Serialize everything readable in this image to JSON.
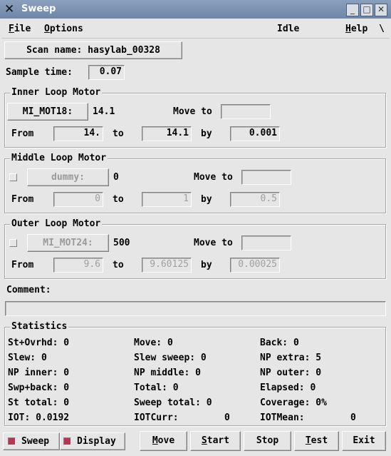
{
  "window": {
    "title": "Sweep"
  },
  "menubar": {
    "file": "File",
    "options": "Options",
    "status": "Idle",
    "help": "Help",
    "help_tail": "\\"
  },
  "scan": {
    "name_label": "Scan name: hasylab_00328",
    "sample_time_label": "Sample time:",
    "sample_time": "0.07"
  },
  "inner": {
    "title": "Inner Loop Motor",
    "motor": "MI_MOT18:",
    "position": "14.1",
    "move_to_label": "Move to",
    "move_to": "",
    "from_label": "From",
    "from": "14.",
    "to_label": "to",
    "to": "14.1",
    "by_label": "by",
    "by": "0.001"
  },
  "middle": {
    "title": "Middle Loop Motor",
    "motor": "dummy:",
    "position": "0",
    "move_to_label": "Move to",
    "move_to": "",
    "from_label": "From",
    "from": "0",
    "to_label": "to",
    "to": "1",
    "by_label": "by",
    "by": "0.5"
  },
  "outer": {
    "title": "Outer Loop Motor",
    "motor": "MI_MOT24:",
    "position": "500",
    "move_to_label": "Move to",
    "move_to": "",
    "from_label": "From",
    "from": "9.6",
    "to_label": "to",
    "to": "9.60125",
    "by_label": "by",
    "by": "0.00025"
  },
  "comment": {
    "label": "Comment:",
    "value": ""
  },
  "statistics": {
    "title": "Statistics",
    "rows": [
      [
        "St+Ovrhd: 0",
        "Move: 0",
        "Back: 0"
      ],
      [
        "Slew: 0",
        "Slew sweep: 0",
        "NP extra: 5"
      ],
      [
        "NP inner: 0",
        "NP middle: 0",
        "NP outer: 0"
      ],
      [
        "Swp+back: 0",
        "Total: 0",
        "Elapsed: 0"
      ],
      [
        "St total: 0",
        "Sweep total: 0",
        "Coverage: 0%"
      ],
      [
        "IOT: 0.0192",
        "IOTCurr:",
        "IOTMean:"
      ]
    ],
    "iotcurr_value": "0",
    "iotmean_value": "0"
  },
  "bottom": {
    "sweep_label": "Sweep",
    "display_label": "Display",
    "move": "Move",
    "start": "Start",
    "stop": "Stop",
    "test": "Test",
    "exit": "Exit"
  },
  "colors": {
    "titlebar": "#7a8fb0",
    "checkbox_on": "#b03a52",
    "background": "#e6e6e6"
  }
}
